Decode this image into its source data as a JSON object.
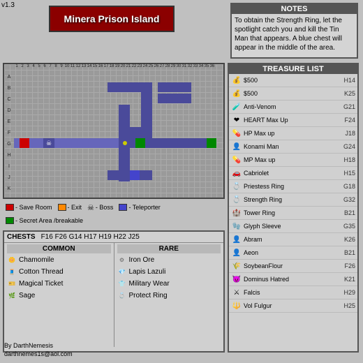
{
  "version": "v1.3",
  "title": "Minera Prison Island",
  "notes": {
    "title": "NOTES",
    "text": "To obtain the Strength Ring, let the spotlight catch you and kill the Tin Man that appears. A blue chest will appear in the middle of the area."
  },
  "legend": {
    "items": [
      {
        "id": "save-room",
        "color": "#cc0000",
        "label": "Save Room"
      },
      {
        "id": "exit",
        "color": "#ff8800",
        "label": "Exit"
      },
      {
        "id": "boss",
        "color": "#ff6600",
        "label": "Boss"
      },
      {
        "id": "teleporter",
        "color": "#4444cc",
        "label": "Teleporter"
      },
      {
        "id": "secret-area",
        "color": "#008800",
        "label": "Secret Area /breakable"
      }
    ]
  },
  "chests": {
    "header_label": "CHESTS",
    "locations": "F16 F26 G14 H17 H19 H22 J25",
    "common_label": "COMMON",
    "rare_label": "RARE",
    "common_items": [
      {
        "name": "Chamomile",
        "icon": "🌼"
      },
      {
        "name": "Cotton Thread",
        "icon": "🧵"
      },
      {
        "name": "Magical Ticket",
        "icon": "🎫"
      },
      {
        "name": "Sage",
        "icon": "🌿"
      }
    ],
    "rare_items": [
      {
        "name": "Iron Ore",
        "icon": "⚙"
      },
      {
        "name": "Lapis Lazuli",
        "icon": "💎"
      },
      {
        "name": "Military Wear",
        "icon": "👕"
      },
      {
        "name": "Protect Ring",
        "icon": "💍"
      }
    ]
  },
  "treasure": {
    "title": "TREASURE LIST",
    "items": [
      {
        "icon": "💰",
        "name": "$500",
        "loc": "H14"
      },
      {
        "icon": "💰",
        "name": "$500",
        "loc": "K25"
      },
      {
        "icon": "🧪",
        "name": "Anti-Venom",
        "loc": "G21"
      },
      {
        "icon": "❤",
        "name": "HEART Max Up",
        "loc": "F24"
      },
      {
        "icon": "💊",
        "name": "HP Max up",
        "loc": "J18"
      },
      {
        "icon": "👤",
        "name": "Konami Man",
        "loc": "G24"
      },
      {
        "icon": "💊",
        "name": "MP Max up",
        "loc": "H18"
      },
      {
        "icon": "🚗",
        "name": "Cabriolet",
        "loc": "H15"
      },
      {
        "icon": "💍",
        "name": "Priestess Ring",
        "loc": "G18"
      },
      {
        "icon": "💍",
        "name": "Strength Ring",
        "loc": "G32"
      },
      {
        "icon": "🏰",
        "name": "Tower Ring",
        "loc": "B21"
      },
      {
        "icon": "🧤",
        "name": "Glyph Sleeve",
        "loc": "G35"
      },
      {
        "icon": "👤",
        "name": "Abram",
        "loc": "K26"
      },
      {
        "icon": "👤",
        "name": "Aeon",
        "loc": "B21"
      },
      {
        "icon": "🌾",
        "name": "SoybeanFlour",
        "loc": "F26"
      },
      {
        "icon": "😈",
        "name": "Dominus Hatred",
        "loc": "K21"
      },
      {
        "icon": "⚔",
        "name": "Falcis",
        "loc": "H29"
      },
      {
        "icon": "🔱",
        "name": "Vol Fulgur",
        "loc": "H25"
      }
    ]
  },
  "credit": {
    "by": "By DarthNemesis",
    "email": "darthnemes1s@aol.com"
  }
}
